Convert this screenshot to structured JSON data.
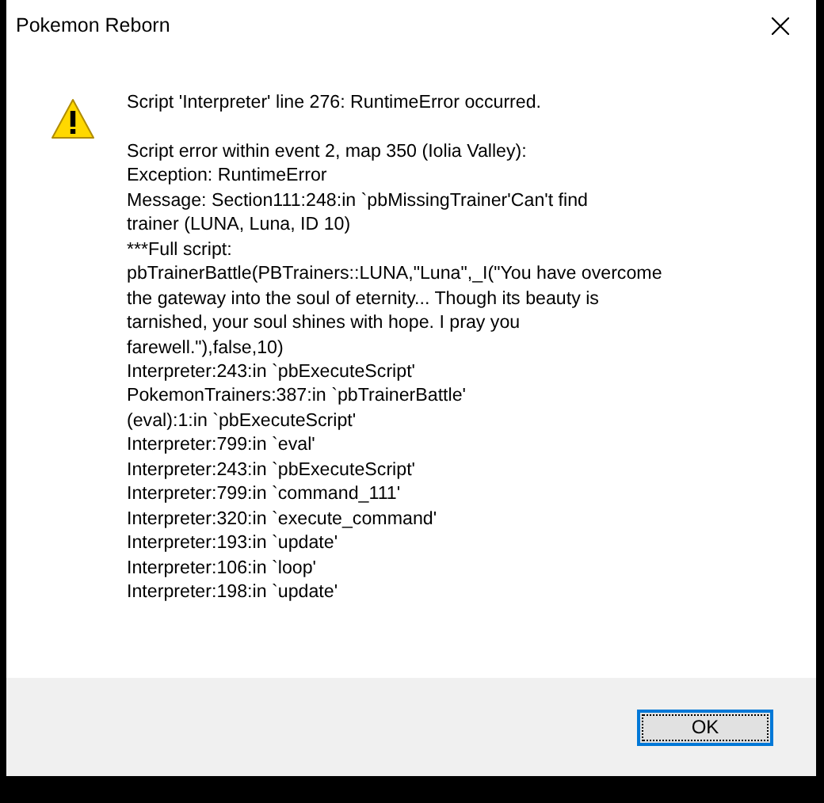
{
  "window": {
    "title": "Pokemon Reborn"
  },
  "message": {
    "heading": "Script 'Interpreter' line 276: RuntimeError occurred.",
    "lines": [
      "Script error within event 2, map 350 (Iolia Valley):",
      "Exception: RuntimeError",
      "Message: Section111:248:in `pbMissingTrainer'Can't find",
      "trainer (LUNA, Luna, ID 10)",
      "***Full script:",
      "pbTrainerBattle(PBTrainers::LUNA,\"Luna\",_I(\"You have overcome",
      "the gateway into the soul of eternity... Though its beauty is",
      "tarnished, your soul shines with hope. I pray you",
      "farewell.\"),false,10)",
      "Interpreter:243:in `pbExecuteScript'",
      "PokemonTrainers:387:in `pbTrainerBattle'",
      "(eval):1:in `pbExecuteScript'",
      "Interpreter:799:in `eval'",
      "Interpreter:243:in `pbExecuteScript'",
      "Interpreter:799:in `command_111'",
      "Interpreter:320:in `execute_command'",
      "Interpreter:193:in `update'",
      "Interpreter:106:in `loop'",
      "Interpreter:198:in `update'"
    ]
  },
  "buttons": [
    {
      "label": "OK",
      "focused": true
    }
  ]
}
